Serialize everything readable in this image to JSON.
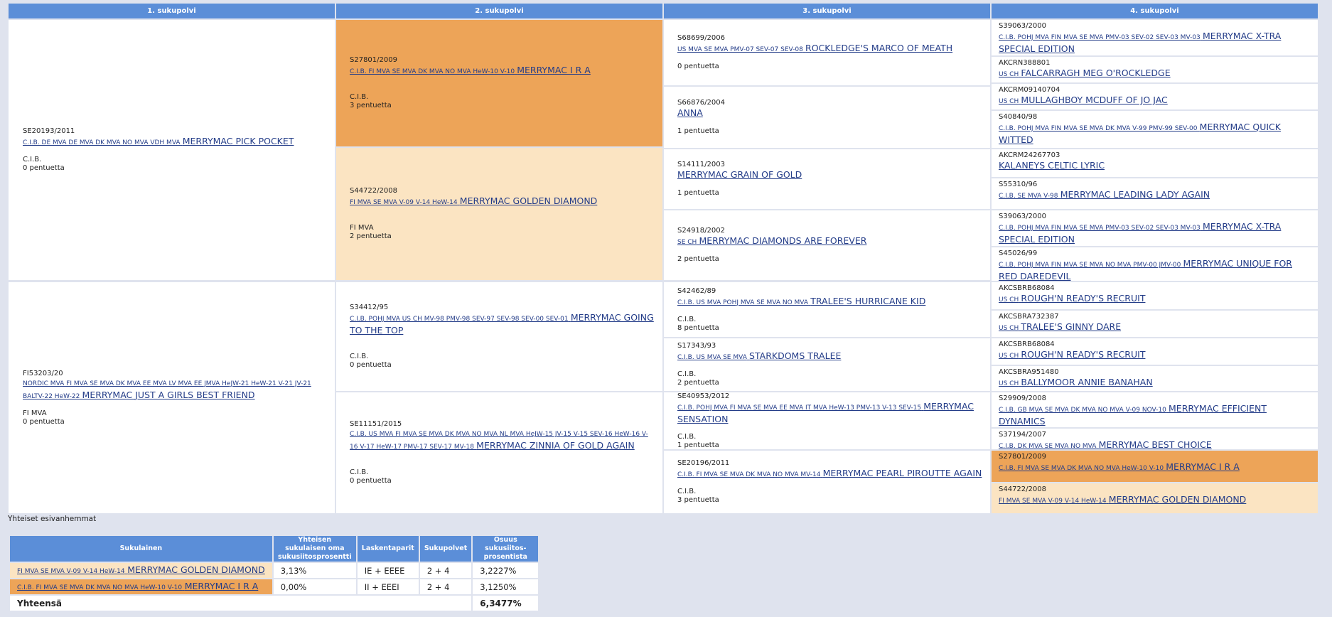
{
  "headers": [
    "1. sukupolvi",
    "2. sukupolvi",
    "3. sukupolvi",
    "4. sukupolvi"
  ],
  "gen1": [
    {
      "reg": "SE20193/2011",
      "titles": "C.I.B. DE MVA DE MVA DK MVA NO MVA VDH MVA",
      "name": "MERRYMAC PICK POCKET",
      "title_line": "C.I.B.",
      "litters": "0 pentuetta"
    },
    {
      "reg": "FI53203/20",
      "titles": "NORDIC MVA FI MVA SE MVA DK MVA EE MVA LV MVA EE JMVA HeJW-21 HeW-21 V-21 JV-21 BALTV-22 HeW-22",
      "name": "MERRYMAC JUST A GIRLS BEST FRIEND",
      "title_line": "FI MVA",
      "litters": "0 pentuetta"
    }
  ],
  "gen2": [
    {
      "reg": "S27801/2009",
      "titles": "C.I.B. FI MVA SE MVA DK MVA NO MVA HeW-10 V-10",
      "name": "MERRYMAC I R A",
      "title_line": "C.I.B.",
      "litters": "3 pentuetta"
    },
    {
      "reg": "S44722/2008",
      "titles": "FI MVA SE MVA V-09 V-14 HeW-14",
      "name": "MERRYMAC GOLDEN DIAMOND",
      "title_line": "FI MVA",
      "litters": "2 pentuetta"
    },
    {
      "reg": "S34412/95",
      "titles": "C.I.B. POHJ MVA US CH MV-98 PMV-98 SEV-97 SEV-98 SEV-00 SEV-01",
      "name": "MERRYMAC GOING TO THE TOP",
      "title_line": "C.I.B.",
      "litters": "0 pentuetta"
    },
    {
      "reg": "SE11151/2015",
      "titles": "C.I.B. US MVA FI MVA SE MVA DK MVA NO MVA NL MVA HeJW-15 JV-15 V-15 SEV-16 HeW-16 V-16 V-17 HeW-17 PMV-17 SEV-17 MV-18",
      "name": "MERRYMAC ZINNIA OF GOLD AGAIN",
      "title_line": "C.I.B.",
      "litters": "0 pentuetta"
    }
  ],
  "gen3": [
    {
      "reg": "S68699/2006",
      "titles": "US MVA SE MVA PMV-07 SEV-07 SEV-08",
      "name": "ROCKLEDGE'S MARCO OF MEATH",
      "title_line": "",
      "litters": "0 pentuetta"
    },
    {
      "reg": "S66876/2004",
      "titles": "",
      "name": "ANNA",
      "title_line": "",
      "litters": "1 pentuetta"
    },
    {
      "reg": "S14111/2003",
      "titles": "",
      "name": "MERRYMAC GRAIN OF GOLD",
      "title_line": "",
      "litters": "1 pentuetta"
    },
    {
      "reg": "S24918/2002",
      "titles": "SE CH",
      "name": "MERRYMAC DIAMONDS ARE FOREVER",
      "title_line": "",
      "litters": "2 pentuetta"
    },
    {
      "reg": "S42462/89",
      "titles": "C.I.B. US MVA POHJ MVA SE MVA NO MVA",
      "name": "TRALEE'S HURRICANE KID",
      "title_line": "C.I.B.",
      "litters": "8 pentuetta"
    },
    {
      "reg": "S17343/93",
      "titles": "C.I.B. US MVA SE MVA",
      "name": "STARKDOMS TRALEE",
      "title_line": "C.I.B.",
      "litters": "2 pentuetta"
    },
    {
      "reg": "SE40953/2012",
      "titles": "C.I.B. POHJ MVA FI MVA SE MVA EE MVA IT MVA HeW-13 PMV-13 V-13 SEV-15",
      "name": "MERRYMAC SENSATION",
      "title_line": "C.I.B.",
      "litters": "1 pentuetta"
    },
    {
      "reg": "SE20196/2011",
      "titles": "C.I.B. FI MVA SE MVA DK MVA NO MVA MV-14",
      "name": "MERRYMAC PEARL PIROUTTE AGAIN",
      "title_line": "C.I.B.",
      "litters": "3 pentuetta"
    }
  ],
  "gen4": [
    {
      "reg": "S39063/2000",
      "titles": "C.I.B. POHJ MVA FIN MVA SE MVA PMV-03 SEV-02 SEV-03 MV-03",
      "name": "MERRYMAC X-TRA SPECIAL EDITION"
    },
    {
      "reg": "AKCRN388801",
      "titles": "US CH",
      "name": "FALCARRAGH MEG O'ROCKLEDGE"
    },
    {
      "reg": "AKCRM09140704",
      "titles": "US CH",
      "name": "MULLAGHBOY MCDUFF OF JO JAC"
    },
    {
      "reg": "S40840/98",
      "titles": "C.I.B. POHJ MVA FIN MVA SE MVA DK MVA V-99 PMV-99 SEV-00",
      "name": "MERRYMAC QUICK WITTED"
    },
    {
      "reg": "AKCRM24267703",
      "titles": "",
      "name": "KALANEYS CELTIC LYRIC"
    },
    {
      "reg": "S55310/96",
      "titles": "C.I.B. SE MVA V-98",
      "name": "MERRYMAC LEADING LADY AGAIN"
    },
    {
      "reg": "S39063/2000",
      "titles": "C.I.B. POHJ MVA FIN MVA SE MVA PMV-03 SEV-02 SEV-03 MV-03",
      "name": "MERRYMAC X-TRA SPECIAL EDITION"
    },
    {
      "reg": "S45026/99",
      "titles": "C.I.B. POHJ MVA FIN MVA SE MVA NO MVA PMV-00 JMV-00",
      "name": "MERRYMAC UNIQUE FOR RED DAREDEVIL"
    },
    {
      "reg": "AKCSBRB68084",
      "titles": "US CH",
      "name": "ROUGH'N READY'S RECRUIT"
    },
    {
      "reg": "AKCSBRA732387",
      "titles": "US CH",
      "name": "TRALEE'S GINNY DARE"
    },
    {
      "reg": "AKCSBRB68084",
      "titles": "US CH",
      "name": "ROUGH'N READY'S RECRUIT"
    },
    {
      "reg": "AKCSBRA951480",
      "titles": "US CH",
      "name": "BALLYMOOR ANNIE BANAHAN"
    },
    {
      "reg": "S29909/2008",
      "titles": "C.I.B. GB MVA SE MVA DK MVA NO MVA V-09 NOV-10",
      "name": "MERRYMAC EFFICIENT DYNAMICS"
    },
    {
      "reg": "S37194/2007",
      "titles": "C.I.B. DK MVA SE MVA NO MVA",
      "name": "MERRYMAC BEST CHOICE"
    },
    {
      "reg": "S27801/2009",
      "titles": "C.I.B. FI MVA SE MVA DK MVA NO MVA HeW-10 V-10",
      "name": "MERRYMAC I R A"
    },
    {
      "reg": "S44722/2008",
      "titles": "FI MVA SE MVA V-09 V-14 HeW-14",
      "name": "MERRYMAC GOLDEN DIAMOND"
    }
  ],
  "common": {
    "heading": "Yhteiset esivanhemmat",
    "columns": [
      "Sukulainen",
      "Yhteisen sukulaisen oma sukusiitosprosentti",
      "Laskentaparit",
      "Sukupolvet",
      "Osuus sukusiitos-prosentista"
    ],
    "rows": [
      {
        "titles": "FI MVA SE MVA V-09 V-14 HeW-14",
        "name": "MERRYMAC GOLDEN DIAMOND",
        "own": "3,13%",
        "pairs": "IE + EEEE",
        "gens": "2 + 4",
        "share": "3,2227%"
      },
      {
        "titles": "C.I.B. FI MVA SE MVA DK MVA NO MVA HeW-10 V-10",
        "name": "MERRYMAC I R A",
        "own": "0,00%",
        "pairs": "II + EEEI",
        "gens": "2 + 4",
        "share": "3,1250%"
      }
    ],
    "total_label": "Yhteensä",
    "total_value": "6,3477%"
  },
  "colors": {
    "header": "#5b8ed8",
    "dark_highlight": "#eda458",
    "light_highlight": "#fbe4c2",
    "link": "#233c88"
  }
}
